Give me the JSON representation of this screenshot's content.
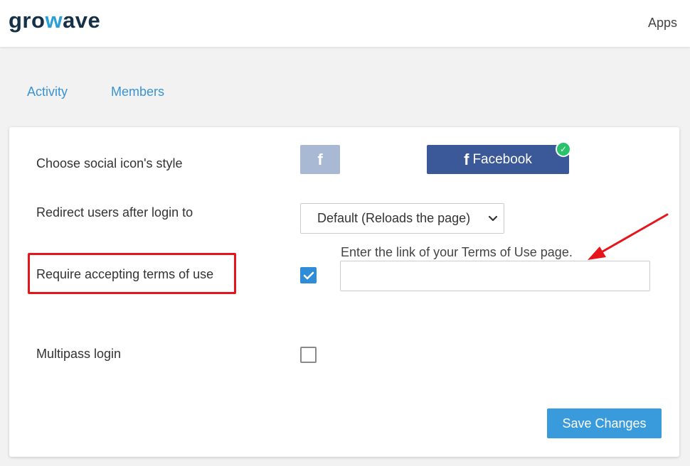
{
  "header": {
    "logo_pre": "gro",
    "logo_accent": "w",
    "logo_post": "ave",
    "apps_label": "Apps"
  },
  "tabs": [
    {
      "label": "Activity"
    },
    {
      "label": "Members"
    }
  ],
  "settings": {
    "icon_style": {
      "label": "Choose social icon's style",
      "square_glyph": "f",
      "full_glyph": "f",
      "full_label": "Facebook",
      "selected_badge": "✓"
    },
    "redirect": {
      "label": "Redirect users after login to",
      "selected_option": "Default (Reloads the page)"
    },
    "terms": {
      "label": "Require accepting terms of use",
      "checked": true,
      "link_hint": "Enter the link of your Terms of Use page.",
      "link_value": ""
    },
    "multipass": {
      "label": "Multipass login",
      "checked": false
    }
  },
  "actions": {
    "save_label": "Save Changes"
  },
  "colors": {
    "accent": "#3a9bdc",
    "facebook": "#3b5998",
    "facebook_light": "#a9b8d3",
    "success": "#27c26a",
    "annotation_red": "#e8141c",
    "logo_dark": "#163047"
  }
}
